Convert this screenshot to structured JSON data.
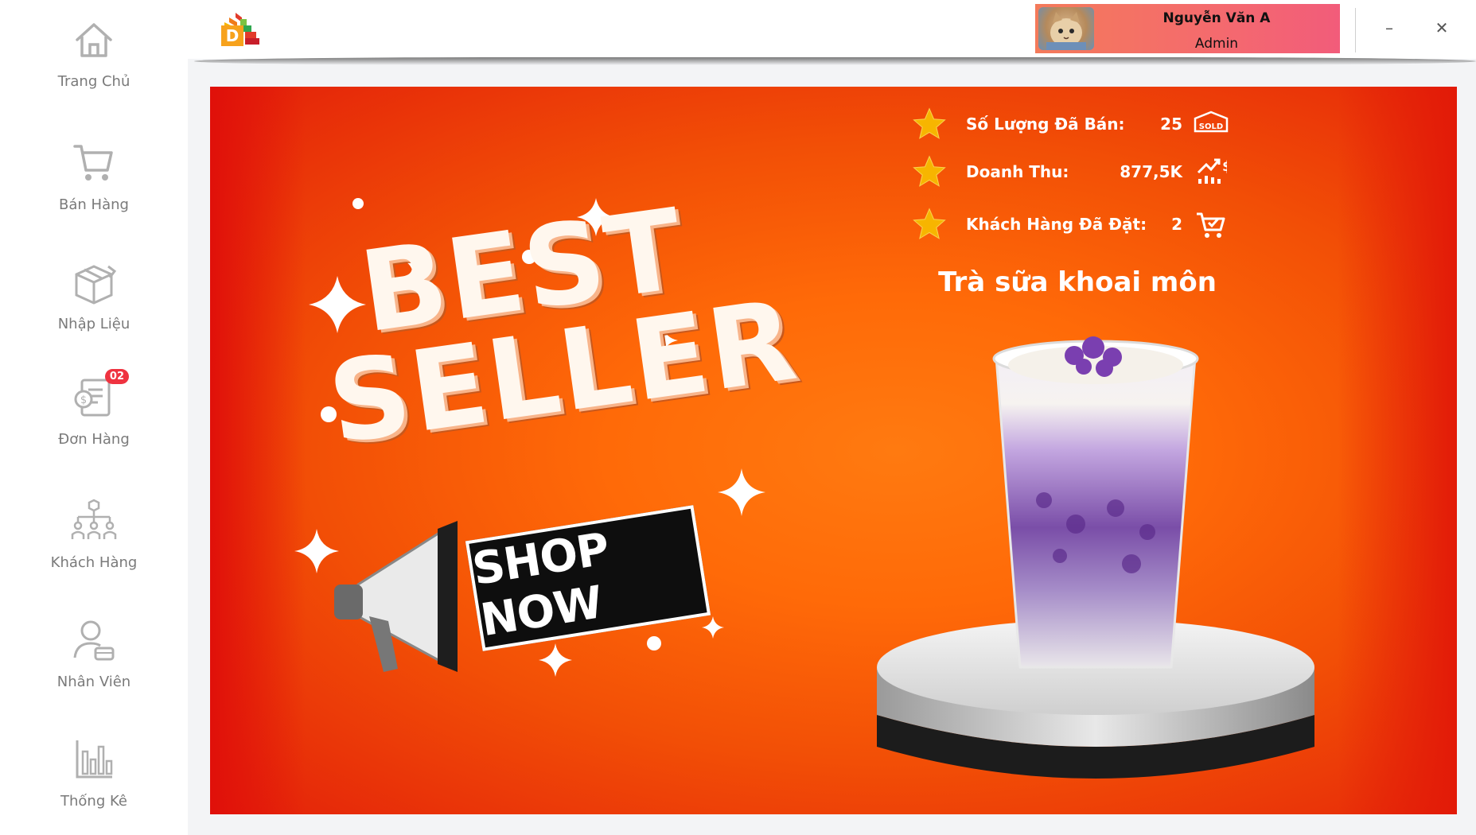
{
  "sidebar": {
    "items": [
      {
        "label": "Trang Chủ",
        "icon": "home-icon"
      },
      {
        "label": "Bán Hàng",
        "icon": "cart-icon"
      },
      {
        "label": "Nhập Liệu",
        "icon": "box-icon"
      },
      {
        "label": "Đơn Hàng",
        "icon": "invoice-icon",
        "badge": "02"
      },
      {
        "label": "Khách Hàng",
        "icon": "customers-network-icon"
      },
      {
        "label": "Nhân Viên",
        "icon": "employee-icon"
      },
      {
        "label": "Thống Kê",
        "icon": "bar-chart-icon"
      }
    ]
  },
  "header": {
    "logo_letter": "D",
    "user": {
      "name": "Nguyễn Văn A",
      "role": "Admin"
    },
    "minimize_label": "–",
    "close_label": "✕"
  },
  "banner": {
    "stats": [
      {
        "label": "Số Lượng Đã Bán:",
        "value": "25",
        "icon": "sold-tag-icon"
      },
      {
        "label": "Doanh Thu:",
        "value": "877,5K",
        "icon": "revenue-growth-icon"
      },
      {
        "label": "Khách Hàng Đã Đặt:",
        "value": "2",
        "icon": "cart-check-icon"
      }
    ],
    "product_title": "Trà sữa khoai môn",
    "headline_1": "BEST",
    "headline_2": "SELLER",
    "cta": "SHOP NOW",
    "colors": {
      "orange": "#ff6a08",
      "red": "#e3200a",
      "gold": "#f7b500"
    }
  }
}
